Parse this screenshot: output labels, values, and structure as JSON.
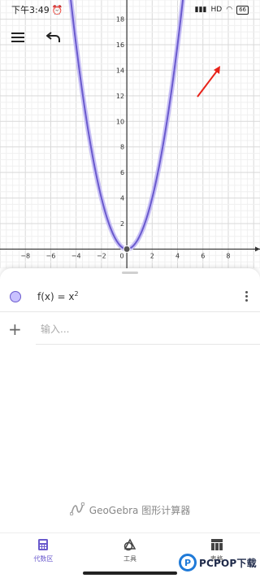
{
  "status_bar": {
    "time": "下午3:49",
    "alarm_icon": "alarm-clock-icon",
    "signal_text": "HD",
    "battery_level": "66"
  },
  "toolbar": {
    "menu_icon": "hamburger-menu-icon",
    "undo_icon": "undo-icon",
    "settings_icon": "gear-icon",
    "highlight_color": "#e8231a"
  },
  "graph": {
    "x_tick_labels": [
      "−8",
      "−6",
      "−4",
      "−2",
      "0",
      "2",
      "4",
      "6",
      "8"
    ],
    "y_tick_labels": [
      "2",
      "4",
      "6",
      "8",
      "10",
      "12",
      "14",
      "16",
      "18"
    ],
    "curve_color": "#6a5acd"
  },
  "chart_data": {
    "type": "line",
    "title": "",
    "xlabel": "",
    "ylabel": "",
    "xlim": [
      -10,
      10.5
    ],
    "ylim": [
      -1.5,
      19.5
    ],
    "grid": true,
    "series": [
      {
        "x": [
          -4.5,
          -4,
          -3.5,
          -3,
          -2.5,
          -2,
          -1.5,
          -1,
          -0.5,
          0,
          0.5,
          1,
          1.5,
          2,
          2.5,
          3,
          3.5,
          4,
          4.5
        ],
        "values": [
          20.25,
          16,
          12.25,
          9,
          6.25,
          4,
          2.25,
          1,
          0.25,
          0,
          0.25,
          1,
          2.25,
          4,
          6.25,
          9,
          12.25,
          16,
          20.25
        ]
      }
    ],
    "points": [
      {
        "x": 0,
        "y": 0
      }
    ]
  },
  "algebra": {
    "function_label": "f(x) = x",
    "function_exponent": "2",
    "input_placeholder": "输入..."
  },
  "branding": {
    "app_name": "GeoGebra 图形计算器"
  },
  "bottom_nav": {
    "items": [
      {
        "label": "代数区",
        "icon": "calculator-icon",
        "active": true
      },
      {
        "label": "工具",
        "icon": "tools-icon",
        "active": false
      },
      {
        "label": "表格",
        "icon": "table-icon",
        "active": false
      }
    ]
  },
  "watermark": {
    "logo_letter": "P",
    "text": "PCPOP下载"
  }
}
